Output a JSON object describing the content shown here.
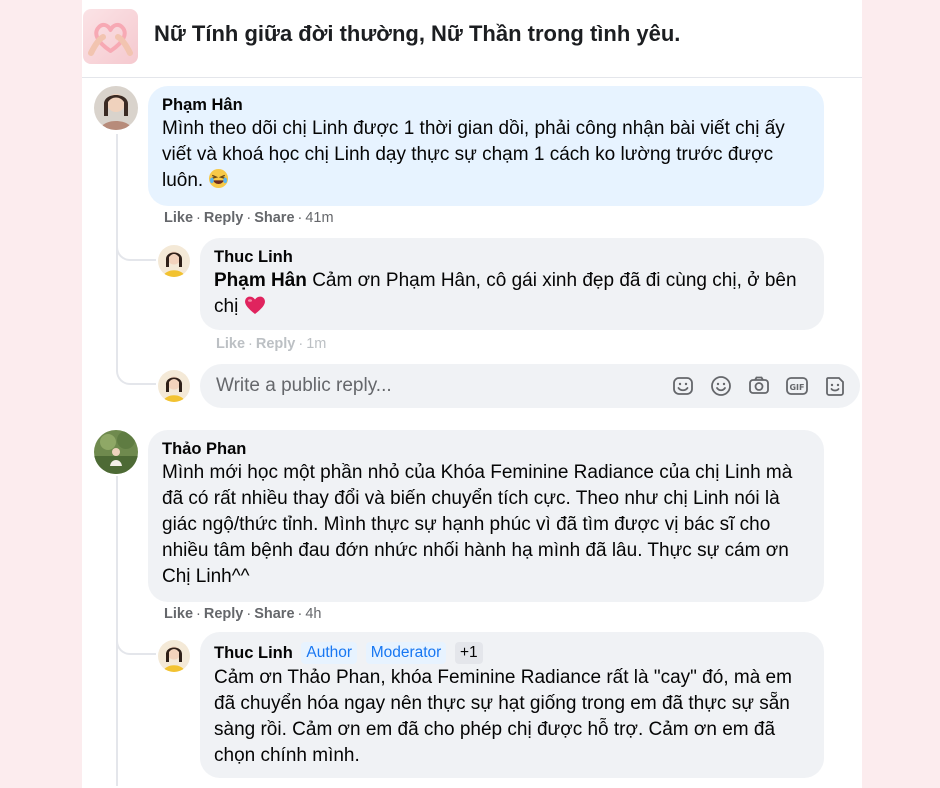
{
  "group": {
    "title": "Nữ Tính giữa đời thường, Nữ Thần trong tình yêu."
  },
  "comments": [
    {
      "author": "Phạm Hân",
      "text": "Mình theo dõi chị Linh được 1 thời gian dồi, phải công nhận bài viết chị ấy viết và khoá học chị Linh dạy thực sự chạm 1 cách ko lường trước được luôn.",
      "emoji": "😂",
      "actions": {
        "like": "Like",
        "reply": "Reply",
        "share": "Share",
        "time": "41m"
      },
      "reply": {
        "author": "Thuc Linh",
        "mention": "Phạm Hân",
        "text": "Cảm ơn Phạm Hân, cô gái xinh đẹp đã đi cùng chị, ở bên chị",
        "emoji": "❤️",
        "actions": {
          "like": "Like",
          "reply": "Reply",
          "time": "1m"
        }
      }
    },
    {
      "author": "Thảo Phan",
      "text": "Mình mới học một phần nhỏ của Khóa Feminine Radiance của chị Linh mà đã có rất nhiều thay đổi và biến chuyển tích cực. Theo như chị Linh nói là giác ngộ/thức tỉnh. Mình thực sự hạnh phúc vì đã tìm được vị bác sĩ cho nhiều tâm bệnh đau đớn nhức nhối hành hạ mình đã lâu. Thực sự cám ơn Chị Linh^^",
      "actions": {
        "like": "Like",
        "reply": "Reply",
        "share": "Share",
        "time": "4h"
      },
      "reply": {
        "author": "Thuc Linh",
        "badges": [
          "Author",
          "Moderator",
          "+1"
        ],
        "text": "Cảm ơn Thảo Phan, khóa Feminine Radiance rất là \"cay\" đó, mà em đã chuyển hóa ngay nên thực sự hạt giống trong em đã thực sự sẵn sàng rồi. Cảm ơn em đã cho phép chị được hỗ trợ. Cảm ơn em đã chọn chính mình."
      }
    }
  ],
  "reply_box": {
    "placeholder": "Write a public reply...",
    "icons": [
      "sticker-smile-icon",
      "emoji-icon",
      "camera-icon",
      "gif-icon",
      "sticker-icon"
    ]
  },
  "colors": {
    "background": "#fcecee",
    "bubble_blue": "#e7f3ff",
    "bubble_gray": "#f0f2f5",
    "link_blue": "#1877f2",
    "muted": "#65676b",
    "heart": "#e0245e"
  }
}
